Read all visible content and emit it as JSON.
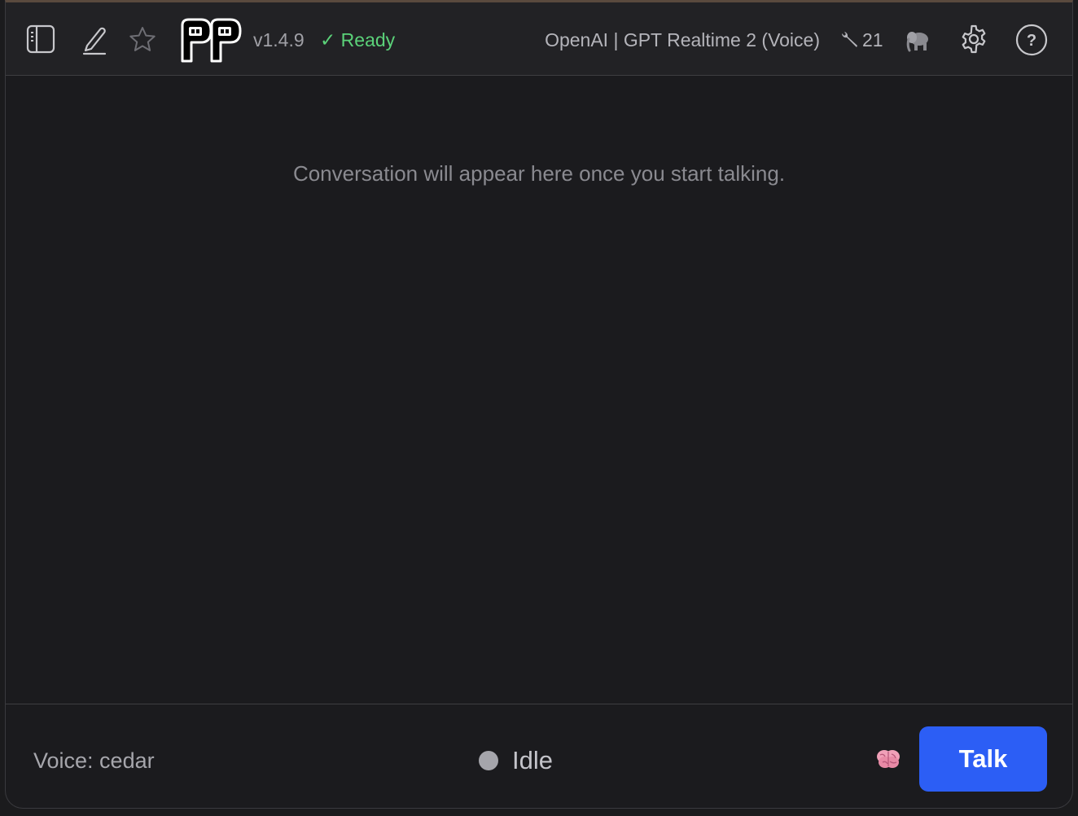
{
  "header": {
    "version": "v1.4.9",
    "status": "✓ Ready",
    "status_color": "#5bd279",
    "model": "OpenAI | GPT Realtime 2 (Voice)",
    "tools_count": "21",
    "icons": [
      "sidebar-toggle-icon",
      "edit-icon",
      "star-icon",
      "app-logo",
      "wrench-icon",
      "elephant-icon",
      "gear-icon",
      "help-icon"
    ]
  },
  "main": {
    "empty_message": "Conversation will appear here once you start talking."
  },
  "footer": {
    "voice_label": "Voice: cedar",
    "state_label": "Idle",
    "talk_label": "Talk",
    "talk_color": "#2c5ef5"
  }
}
